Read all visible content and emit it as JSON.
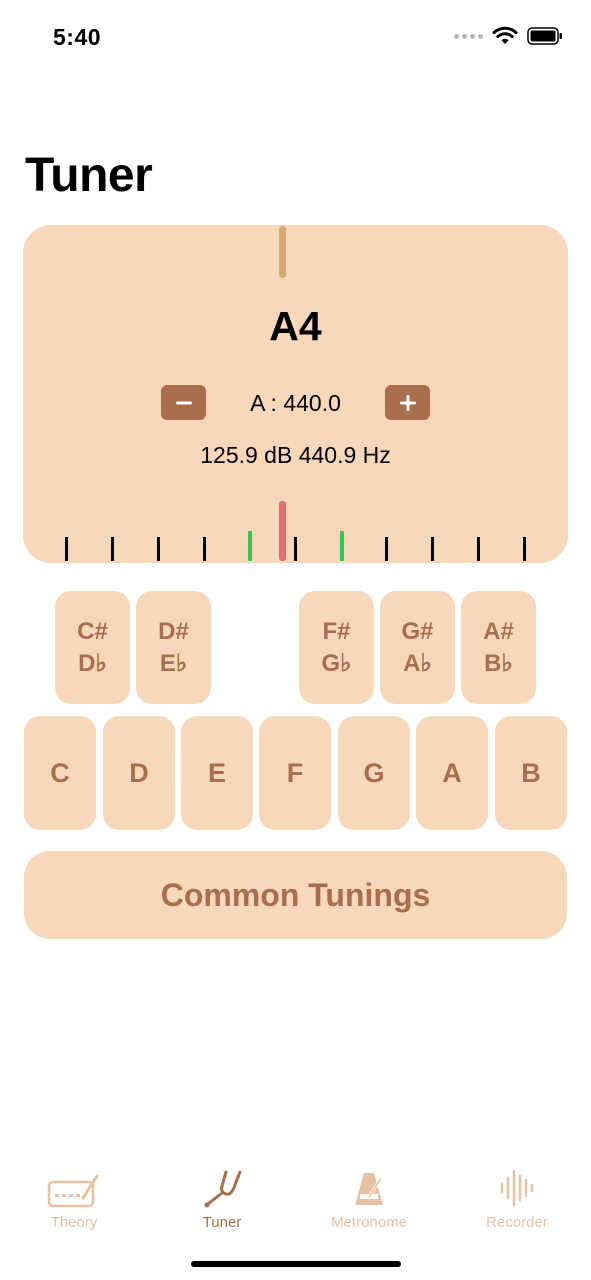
{
  "status_bar": {
    "time": "5:40"
  },
  "page": {
    "title": "Tuner"
  },
  "tuner": {
    "note": "A4",
    "reference": "A : 440.0",
    "readout": "125.9 dB  440.9 Hz",
    "decrease_label": "−",
    "increase_label": "+"
  },
  "keyboard": {
    "sharps": [
      {
        "top": "C#",
        "bottom": "D♭"
      },
      {
        "top": "D#",
        "bottom": "E♭"
      },
      {
        "top": "F#",
        "bottom": "G♭"
      },
      {
        "top": "G#",
        "bottom": "A♭"
      },
      {
        "top": "A#",
        "bottom": "B♭"
      }
    ],
    "naturals": [
      "C",
      "D",
      "E",
      "F",
      "G",
      "A",
      "B"
    ]
  },
  "common_tunings_label": "Common Tunings",
  "tabs": [
    {
      "label": "Theory",
      "icon": "keyboard-icon",
      "active": false
    },
    {
      "label": "Tuner",
      "icon": "tuning-fork-icon",
      "active": true
    },
    {
      "label": "Metronome",
      "icon": "metronome-icon",
      "active": false
    },
    {
      "label": "Recorder",
      "icon": "waveform-icon",
      "active": false
    }
  ],
  "colors": {
    "accent": "#a86e4d",
    "panel": "#f7d8bb",
    "needle": "#e07070",
    "in_tune_marks": "#3cc453",
    "inactive_tab": "#e6c2a3"
  }
}
